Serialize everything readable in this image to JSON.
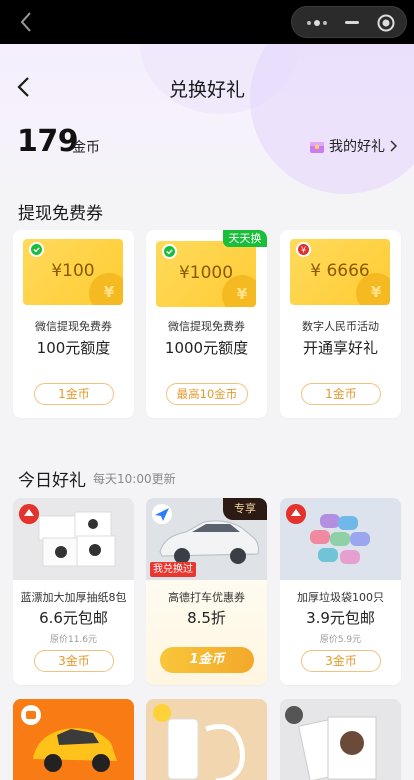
{
  "header": {
    "title": "兑换好礼",
    "coins": "179",
    "coin_unit": "金币",
    "my_gifts": "我的好礼"
  },
  "section_vouchers": {
    "title": "提现免费券",
    "items": [
      {
        "amount": "¥100",
        "line1": "微信提现免费券",
        "line2": "100元额度",
        "price": "1金币",
        "badge": "wechat-icon"
      },
      {
        "amount": "¥1000",
        "line1": "微信提现免费券",
        "line2": "1000元额度",
        "price": "最高10金币",
        "tag": "天天换",
        "badge": "wechat-icon"
      },
      {
        "amount": "¥ 6666",
        "line1": "数字人民币活动",
        "line2": "开通享好礼",
        "price": "1金币",
        "badge": "digital-rmb-icon"
      }
    ]
  },
  "section_today": {
    "title": "今日好礼",
    "subtitle": "每天10:00更新",
    "items": [
      {
        "name": "蓝漂加大加厚抽纸8包",
        "price": "6.6元包邮",
        "original": "原价11.6元",
        "button": "3金币"
      },
      {
        "name": "高德打车优惠券",
        "price": "8.5折",
        "button": "1金币",
        "tag": "专享",
        "status": "我兑换过"
      },
      {
        "name": "加厚垃圾袋100只",
        "price": "3.9元包邮",
        "original": "原价5.9元",
        "button": "3金币"
      }
    ]
  },
  "colors": {
    "accent": "#f3a82a",
    "voucher": "#ffcc33",
    "wechat_green": "#19be3b",
    "brand_red": "#e4322d"
  }
}
